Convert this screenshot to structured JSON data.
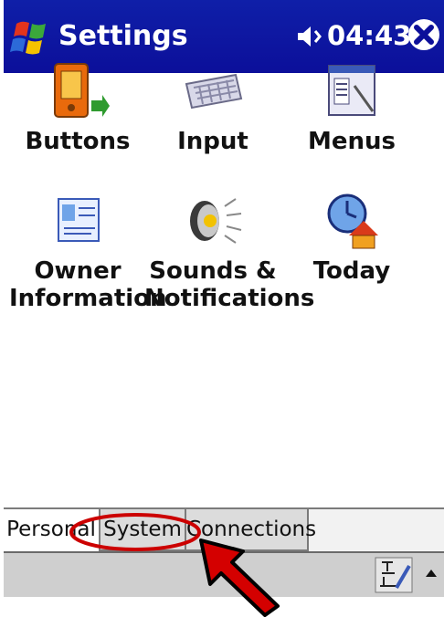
{
  "titlebar": {
    "title": "Settings",
    "time": "04:43"
  },
  "icons": [
    "windows-start-icon",
    "speaker-icon",
    "close-icon"
  ],
  "apps": [
    {
      "label": "Buttons",
      "icon": "buttons-icon"
    },
    {
      "label": "Input",
      "icon": "keyboard-icon"
    },
    {
      "label": "Menus",
      "icon": "menus-icon"
    },
    {
      "label": "Owner\nInformation",
      "icon": "owner-card-icon"
    },
    {
      "label": "Sounds &\nNotifications",
      "icon": "speaker-sound-icon"
    },
    {
      "label": "Today",
      "icon": "today-clock-house-icon"
    }
  ],
  "tabs": [
    {
      "label": "Personal",
      "active": true
    },
    {
      "label": "System",
      "active": false
    },
    {
      "label": "Connections",
      "active": false
    }
  ],
  "colors": {
    "titlebar": "#0c0f9a",
    "annotation": "#cc0000"
  }
}
